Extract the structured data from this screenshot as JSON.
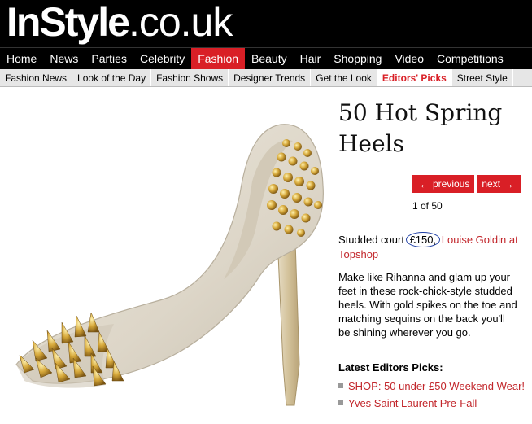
{
  "header": {
    "brand": "InStyle",
    "domain": ".co.uk"
  },
  "nav": {
    "items": [
      "Home",
      "News",
      "Parties",
      "Celebrity",
      "Fashion",
      "Beauty",
      "Hair",
      "Shopping",
      "Video",
      "Competitions"
    ],
    "active": "Fashion"
  },
  "subnav": {
    "items": [
      "Fashion News",
      "Look of the Day",
      "Fashion Shows",
      "Designer Trends",
      "Get the Look",
      "Editors' Picks",
      "Street Style"
    ],
    "active": "Editors' Picks"
  },
  "gallery": {
    "title": "50 Hot Spring Heels",
    "previous_label": "previous",
    "next_label": "next",
    "counter": "1 of 50",
    "caption_prefix": "Studded court ",
    "price": "£150,",
    "caption_link": "Louise Goldin at Topshop",
    "description": "Make like Rihanna and glam up your feet in these rock-chick-style studded heels. With gold spikes on the toe and matching sequins on the back you'll be shining wherever you go."
  },
  "latest": {
    "title": "Latest Editors Picks:",
    "items": [
      "SHOP: 50 under £50 Weekend Wear!",
      "Yves Saint Laurent Pre-Fall"
    ]
  },
  "colors": {
    "accent": "#d91f26",
    "link": "#c2262b",
    "price_circle": "#1f3fa5",
    "shoe": "#e3ddd0",
    "studs": "#c9a13b"
  }
}
